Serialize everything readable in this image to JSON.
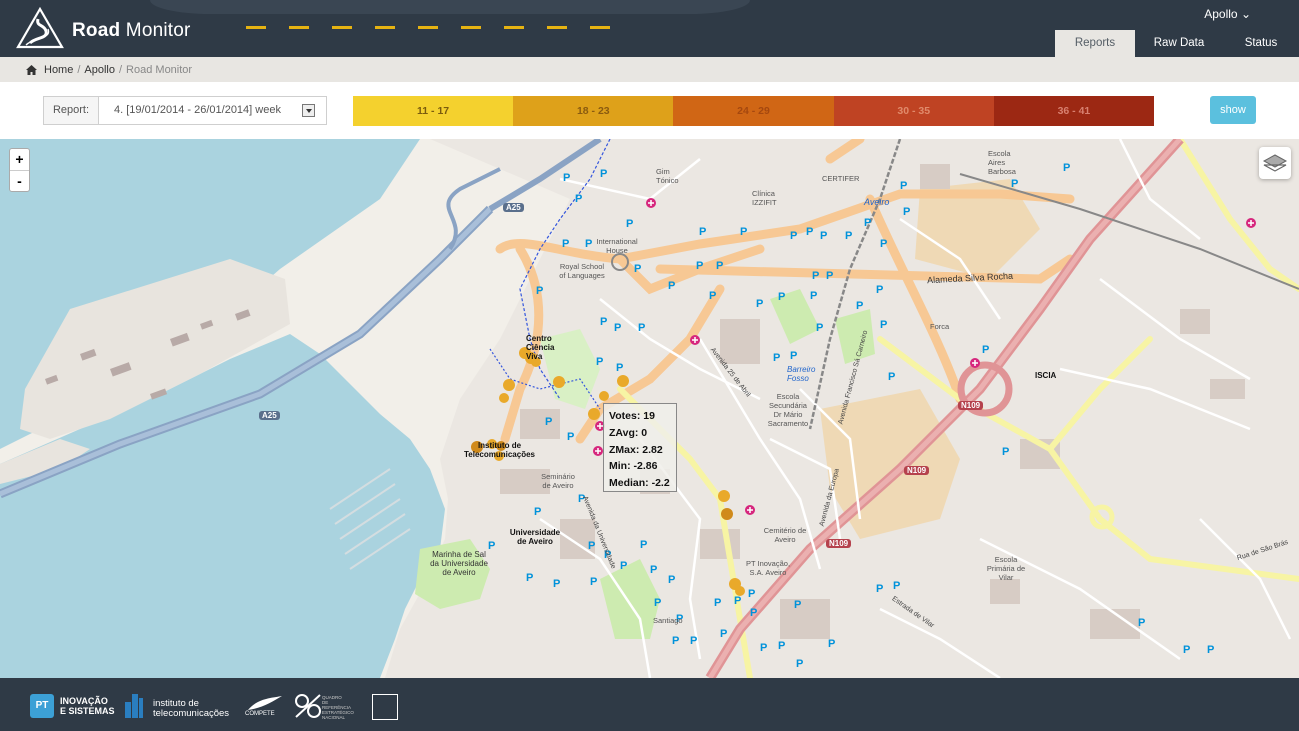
{
  "header": {
    "app_title_bold": "Road",
    "app_title_rest": " Monitor",
    "user": "Apollo ⌄",
    "tabs": [
      {
        "label": "Reports",
        "active": true
      },
      {
        "label": "Raw Data",
        "active": false
      },
      {
        "label": "Status",
        "active": false
      }
    ]
  },
  "breadcrumb": {
    "home": "Home",
    "sep1": "/",
    "apollo": "Apollo",
    "sep2": "/",
    "current": "Road Monitor"
  },
  "toolbar": {
    "report_label": "Report:",
    "report_value": "4. [19/01/2014 - 26/01/2014] week",
    "show_label": "show",
    "legend": [
      {
        "label": "11 - 17",
        "color": "#f4d12e",
        "text_color": "#7a5c0e"
      },
      {
        "label": "18 - 23",
        "color": "#dea11a",
        "text_color": "#8a5b10"
      },
      {
        "label": "24 - 29",
        "color": "#d06615",
        "text_color": "#a5480f"
      },
      {
        "label": "30 - 35",
        "color": "#bf4323",
        "text_color": "#e08a6b"
      },
      {
        "label": "36 - 41",
        "color": "#9c2813",
        "text_color": "#d88070"
      }
    ]
  },
  "map": {
    "zoom_in": "+",
    "zoom_out": "-",
    "popup": {
      "votes": "Votes: 19",
      "zavg": "ZAvg: 0",
      "zmax": "ZMax: 2.82",
      "min": "Min: -2.86",
      "median": "Median: -2.2"
    },
    "labels": {
      "roads": [
        "A25",
        "A25",
        "N109",
        "N109",
        "N109"
      ],
      "alameda": "Alameda Silva Rocha",
      "aveiro": "Aveiro",
      "certifer": "CERTIFER",
      "clinica": "Clínica IZZIFIT",
      "gim": "Gim Tónico",
      "intl_house": "International House",
      "royal_school": "Royal School of Languages",
      "centro": "Centro Ciência Viva",
      "instituto": "Instituto de Telecomunicações",
      "seminario": "Seminário de Aveiro",
      "universidade": "Universidade de Aveiro",
      "marinha": "Marinha de Sal da Universidade de Aveiro",
      "escola_mario": "Escola Secundária Dr Mário Sacramento",
      "cemiterio": "Cemitério de Aveiro",
      "pt_inovacao": "PT Inovação, S.A. Aveiro",
      "iscia": "ISCIA",
      "barreiro": "Barreiro Fosso",
      "escola_vilar": "Escola Primária de Vilar",
      "escola_aires": "Escola Aires Barbosa",
      "forca": "Forca",
      "santiago": "Santiago",
      "av_universidade": "Avenida da Universidade",
      "av_25abril": "Avenida 25 de Abril",
      "av_sa_carneiro": "Avenida Francisco Sá Carneiro",
      "estrada_vilar": "Estrada de Vilar",
      "av_europa": "Avenida da Europa",
      "rua_sao_bras": "Rua de São Brás"
    }
  },
  "footer": {
    "pt_logo": "PT",
    "pt_text_1": "INOVAÇÃO",
    "pt_text_2": "E SISTEMAS",
    "it_text_1": "instituto de",
    "it_text_2": "telecomunicações",
    "compete": "COMPETE",
    "qren_text": "QUADRO DE REFERÊNCIA ESTRATÉGICO NACIONAL"
  }
}
